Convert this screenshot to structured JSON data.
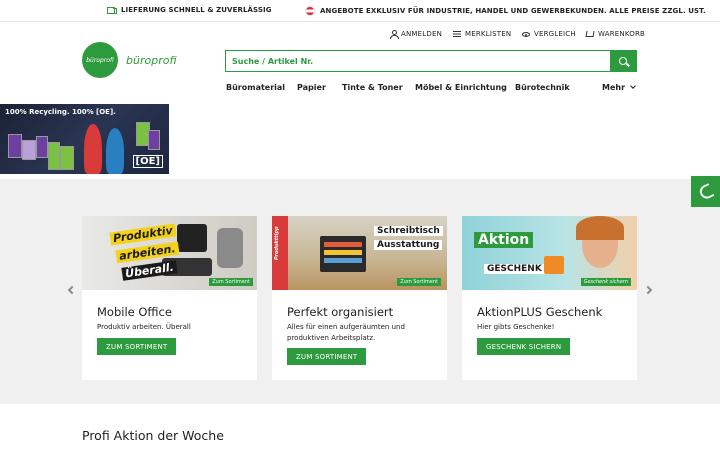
{
  "topbar": {
    "left_text": "LIEFERUNG SCHNELL & ZUVERLÄSSIG",
    "right_text": "ANGEBOTE EXKLUSIV FÜR INDUSTRIE, HANDEL UND GEWERBEKUNDEN. ALLE PREISE ZZGL. UST."
  },
  "brand": {
    "circle_text": "büroprofi",
    "name": "büroprofi",
    "color": "#2e9a3e"
  },
  "utility_nav": {
    "login": "ANMELDEN",
    "lists": "MERKLISTEN",
    "compare": "VERGLEICH",
    "cart": "WARENKORB"
  },
  "search": {
    "placeholder": "Suche / Artikel Nr."
  },
  "main_nav": [
    "Büromaterial",
    "Papier",
    "Tinte & Toner",
    "Möbel & Einrichtung",
    "Bürotechnik",
    "Mehr"
  ],
  "banner": {
    "text": "100% Recycling. 100% [OE].",
    "badge": "[OE]"
  },
  "cards": [
    {
      "title": "Mobile Office",
      "description": "Produktiv arbeiten. Überall",
      "button": "ZUM SORTIMENT",
      "image_text_1": "Produktiv",
      "image_text_2": "arbeiten.",
      "image_text_3": "Überall.",
      "image_tag": "Zum Sortiment"
    },
    {
      "title": "Perfekt organisiert",
      "description": "Alles für einen aufgeräumten und produktiven Arbeitsplatz.",
      "button": "ZUM SORTIMENT",
      "image_text_1": "Schreibtisch",
      "image_text_2": "Ausstattung",
      "image_tag": "Zum Sortiment",
      "image_side": "Produkttipp"
    },
    {
      "title": "AktionPLUS Geschenk",
      "description": "Hier gibts Geschenke!",
      "button": "GESCHENK SICHERN",
      "image_text_1": "Aktion",
      "image_text_2": "GESCHENK",
      "image_tag": "Geschenk sichern"
    }
  ],
  "section": {
    "title": "Profi Aktion der Woche"
  }
}
